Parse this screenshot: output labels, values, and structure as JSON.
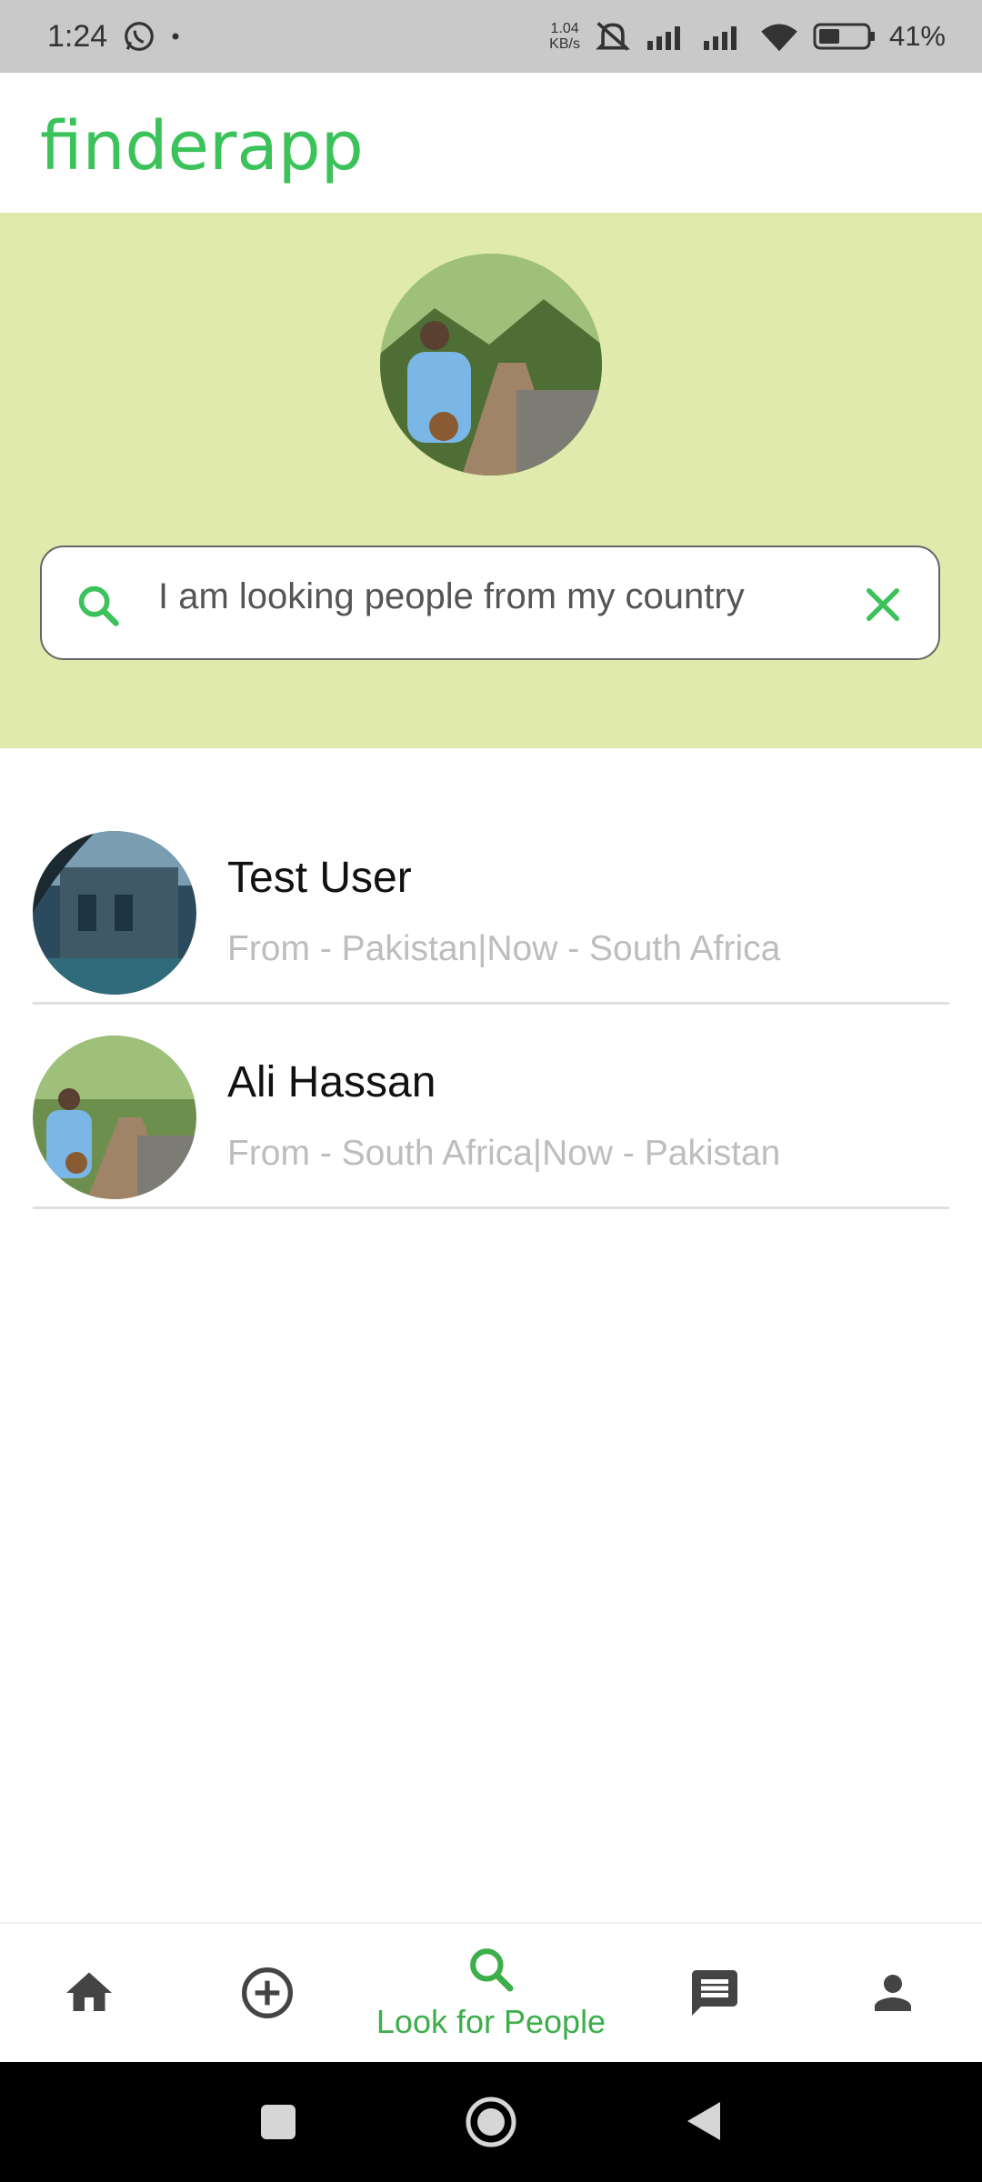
{
  "status_bar": {
    "time": "1:24",
    "net_speed_value": "1.04",
    "net_speed_unit": "KB/s",
    "battery": "41%",
    "icons": [
      "whatsapp-icon",
      "dot-icon",
      "mute-icon",
      "signal-icon",
      "signal-icon",
      "wifi-icon",
      "battery-icon"
    ]
  },
  "header": {
    "title": "finderapp"
  },
  "colors": {
    "brand": "#3cc25a",
    "hero_bg": "#dfeaac",
    "nav_active": "#3cae4a",
    "nav_inactive": "#444444"
  },
  "search": {
    "value": "I am looking people from my country",
    "icon": "search-icon",
    "clear_icon": "close-icon"
  },
  "results": [
    {
      "name": "Test User",
      "subtitle": "From - Pakistan|Now - South Africa"
    },
    {
      "name": "Ali Hassan",
      "subtitle": "From - South Africa|Now - Pakistan"
    }
  ],
  "bottom_nav": {
    "items": [
      {
        "icon": "home-icon",
        "label": ""
      },
      {
        "icon": "add-circle-icon",
        "label": ""
      },
      {
        "icon": "search-icon",
        "label": "Look for People",
        "active": true
      },
      {
        "icon": "chat-icon",
        "label": ""
      },
      {
        "icon": "person-icon",
        "label": ""
      }
    ]
  },
  "system_nav": {
    "icons": [
      "recents-square-icon",
      "home-circle-icon",
      "back-triangle-icon"
    ]
  }
}
